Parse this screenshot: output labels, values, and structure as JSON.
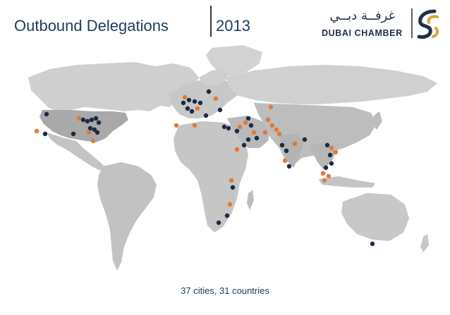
{
  "header": {
    "title": "Outbound Delegations",
    "year": "2013"
  },
  "logo": {
    "arabic": "غرفــة دبــي",
    "english": "DUBAI CHAMBER"
  },
  "colors": {
    "navy_marker": "#1b2a45",
    "orange_marker": "#e07a36",
    "land": "#c6c6c6",
    "land_dark": "#a9a9a9",
    "title": "#1f3a5f"
  },
  "caption": "37 cities, 31 countries"
}
